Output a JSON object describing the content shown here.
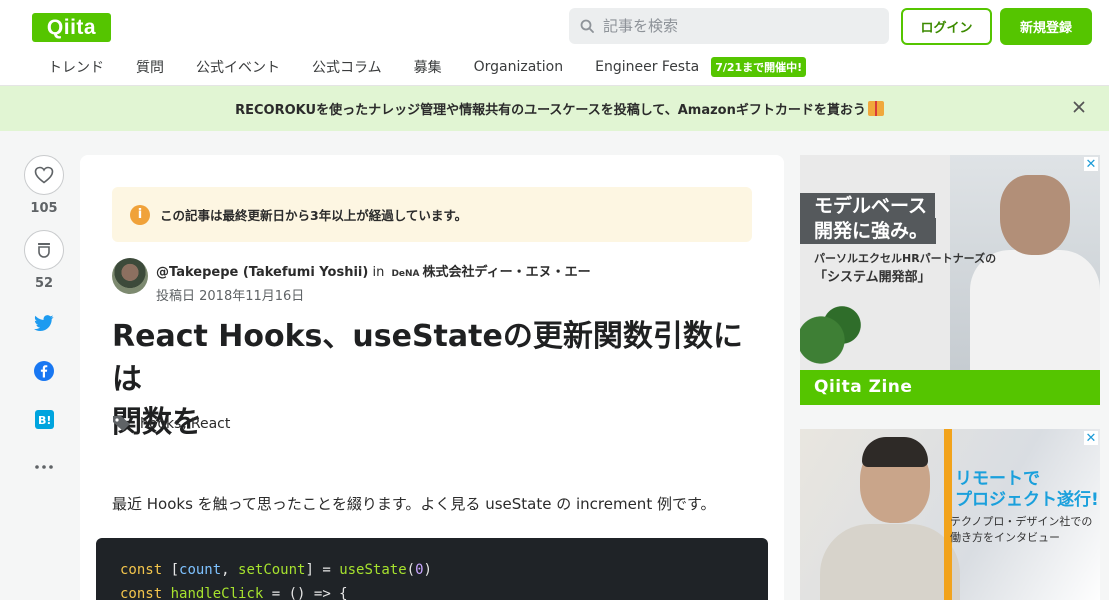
{
  "header": {
    "logo": "Qiita",
    "search_placeholder": "記事を検索",
    "login_label": "ログイン",
    "signup_label": "新規登録"
  },
  "nav": {
    "items": [
      "トレンド",
      "質問",
      "公式イベント",
      "公式コラム",
      "募集",
      "Organization",
      "Engineer Festa"
    ],
    "badge": "7/21まで開催中!"
  },
  "banner": {
    "text": "RECOROKUを使ったナレッジ管理や情報共有のユースケースを投稿して、Amazonギフトカードを貰おう",
    "icon": "gift-icon",
    "close_icon": "close-icon"
  },
  "rail": {
    "like_count": "105",
    "stock_count": "52",
    "icons": [
      "heart-icon",
      "stock-icon",
      "twitter-icon",
      "facebook-icon",
      "hatena-bookmark-icon",
      "more-icon"
    ]
  },
  "article": {
    "notice": "この記事は最終更新日から3年以上が経過しています。",
    "author": "@Takepepe (Takefumi Yoshii)",
    "in_label": "in",
    "org_logo": "DeNA",
    "organization": "株式会社ディー・エヌ・エー",
    "posted": "投稿日 2018年11月16日",
    "title_line1": "React Hooks、useStateの更新関数引数には",
    "title_line2": "関数を",
    "tags": [
      "hooks",
      "React"
    ],
    "intro": "最近 Hooks を触って思ったことを綴ります。よく見る useState の increment 例です。",
    "code": {
      "l1_const": "const",
      "l1_open": " [",
      "l1_count": "count",
      "l1_comma": ", ",
      "l1_set": "setCount",
      "l1_close": "] = ",
      "l1_fn": "useState",
      "l1_p1": "(",
      "l1_zero": "0",
      "l1_p2": ")",
      "l2_const": "const",
      "l2_name": " handleClick",
      "l2_rest": " = () => {"
    }
  },
  "ads": {
    "ad1": {
      "headline1": "モデルベース",
      "headline2": "開発に強み。",
      "sub1": "パーソルエクセルHRパートナーズの",
      "sub2": "「システム開発部」",
      "footer": "Qiita Zine",
      "close": "✕"
    },
    "ad2": {
      "headline1": "リモートで",
      "headline2": "プロジェクト遂行!",
      "sub1": "テクノプロ・デザイン社での",
      "sub2": "働き方をインタビュー",
      "close": "✕"
    }
  },
  "colors": {
    "brand": "#55c500",
    "banner_bg": "#e1f5d3",
    "notice_bg": "#fdf6e2"
  }
}
